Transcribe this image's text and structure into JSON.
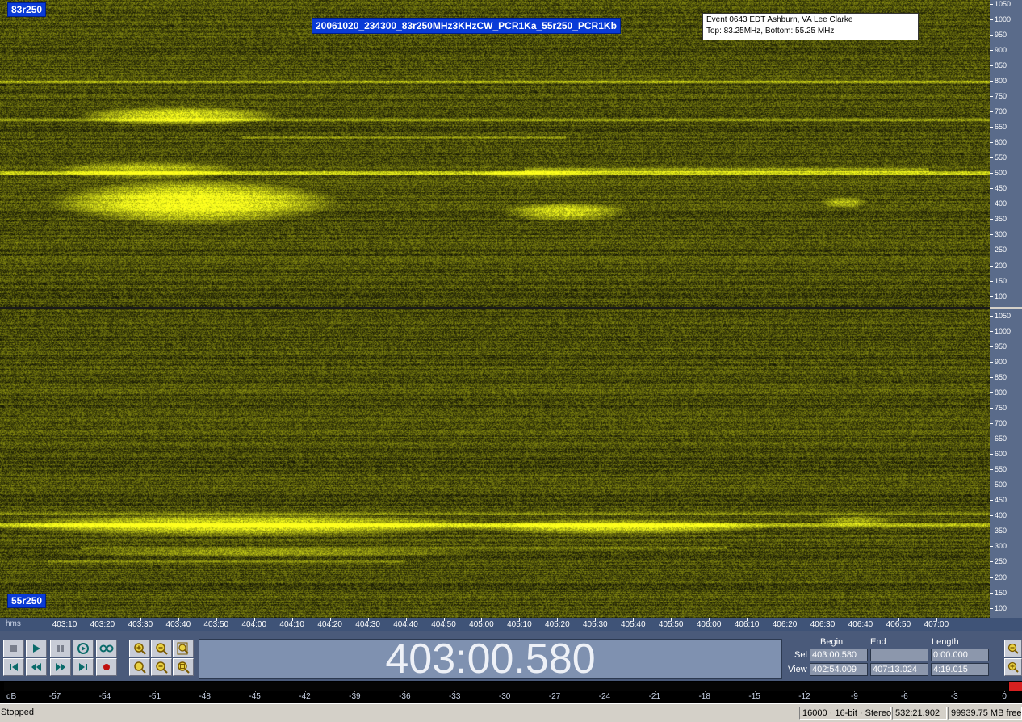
{
  "spectrogram": {
    "top_channel_label": "83r250",
    "bottom_channel_label": "55r250",
    "filename_label": "20061020_234300_83r250MHz3KHzCW_PCR1Ka_55r250_PCR1Kb",
    "event_box": {
      "line1": "Event 0643 EDT Ashburn, VA Lee Clarke",
      "line2": "Top: 83.25MHz, Bottom: 55.25 MHz"
    },
    "y_axis_labels": [
      "1050",
      "1000",
      "950",
      "900",
      "850",
      "800",
      "750",
      "700",
      "650",
      "600",
      "550",
      "500",
      "450",
      "400",
      "350",
      "300",
      "250",
      "200",
      "150",
      "100"
    ],
    "colors": {
      "background": "#3a3d18",
      "signal": "#e8f020"
    }
  },
  "timeline": {
    "unit": "hms",
    "labels": [
      "403:10",
      "403:20",
      "403:30",
      "403:40",
      "403:50",
      "404:00",
      "404:10",
      "404:20",
      "404:30",
      "404:40",
      "404:50",
      "405:00",
      "405:10",
      "405:20",
      "405:30",
      "405:40",
      "405:50",
      "406:00",
      "406:10",
      "406:20",
      "406:30",
      "406:40",
      "406:50",
      "407:00"
    ]
  },
  "transport": {
    "buttons_row1": [
      "stop-icon",
      "play-icon",
      "pause-icon",
      "play-looped-icon",
      "loop-icon"
    ],
    "buttons_row2": [
      "go-to-start-icon",
      "rewind-icon",
      "fast-forward-icon",
      "go-to-end-icon",
      "record-icon"
    ],
    "zoom_row1": [
      "zoom-in-full-icon",
      "zoom-out-full-icon",
      "zoom-selection-icon"
    ],
    "zoom_row2": [
      "zoom-in-vertical-icon",
      "zoom-out-vertical-icon",
      "zoom-region-icon"
    ]
  },
  "time_display": "403:00.580",
  "selection_info": {
    "headers": {
      "begin": "Begin",
      "end": "End",
      "length": "Length"
    },
    "sel": {
      "label": "Sel",
      "begin": "403:00.580",
      "end": "",
      "length": "0:00.000"
    },
    "view": {
      "label": "View",
      "begin": "402:54.009",
      "end": "407:13.024",
      "length": "4:19.015"
    }
  },
  "level_meter": {
    "unit": "dB",
    "labels": [
      "-57",
      "-54",
      "-51",
      "-48",
      "-45",
      "-42",
      "-39",
      "-36",
      "-33",
      "-30",
      "-27",
      "-24",
      "-21",
      "-18",
      "-15",
      "-12",
      "-9",
      "-6",
      "-3",
      "0"
    ]
  },
  "status_bar": {
    "state": "Stopped",
    "format": "16000 · 16-bit · Stereo",
    "duration": "532:21.902",
    "free_space": "99939.75 MB free"
  }
}
